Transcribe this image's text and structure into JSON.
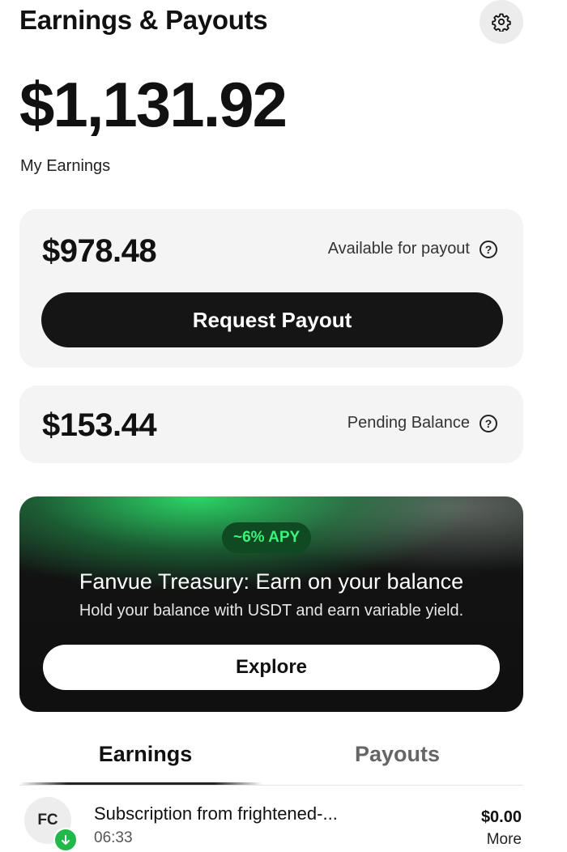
{
  "header": {
    "title": "Earnings & Payouts",
    "settings_icon": "gear-icon"
  },
  "summary": {
    "total_amount": "$1,131.92",
    "total_label": "My Earnings"
  },
  "available": {
    "amount": "$978.48",
    "label": "Available for payout",
    "help_icon": "question-circle-icon",
    "button_label": "Request Payout"
  },
  "pending": {
    "amount": "$153.44",
    "label": "Pending Balance",
    "help_icon": "question-circle-icon"
  },
  "promo": {
    "badge": "~6% APY",
    "title": "Fanvue Treasury: Earn on your balance",
    "subtitle": "Hold your balance with USDT and earn variable yield.",
    "button_label": "Explore",
    "accent_color": "#2ce06a"
  },
  "tabs": [
    {
      "label": "Earnings",
      "active": true
    },
    {
      "label": "Payouts",
      "active": false
    }
  ],
  "transactions": [
    {
      "avatar_initials": "FC",
      "avatar_badge_icon": "arrow-down-icon",
      "title": "Subscription from frightened-...",
      "time": "06:33",
      "amount": "$0.00",
      "action": "More"
    }
  ]
}
